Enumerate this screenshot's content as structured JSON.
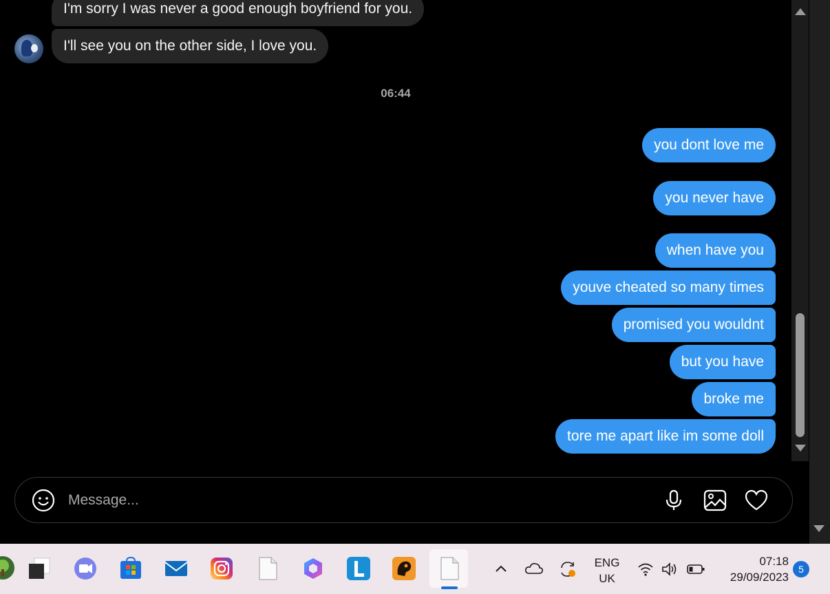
{
  "messages_in": [
    {
      "text": "I'm sorry I was never a good enough boyfriend for you."
    },
    {
      "text": "I'll see you on the other side, I love you."
    }
  ],
  "timestamp": "06:44",
  "messages_out": [
    {
      "text": "you dont love me"
    },
    {
      "text": "you never have"
    },
    {
      "text": "when have you"
    },
    {
      "text": "youve cheated so many times"
    },
    {
      "text": "promised you wouldnt"
    },
    {
      "text": "but you have"
    },
    {
      "text": "broke me"
    },
    {
      "text": "tore me apart like im some doll"
    }
  ],
  "composer": {
    "placeholder": "Message...",
    "icons": [
      "emoji-icon",
      "microphone-icon",
      "image-icon",
      "heart-icon"
    ]
  },
  "colors": {
    "outgoing_bubble": "#3797f0",
    "incoming_bubble": "#262626",
    "background": "#000000",
    "taskbar": "#efe6eb"
  },
  "taskbar": {
    "apps": [
      "tree-app-icon",
      "task-view-icon",
      "teams-icon",
      "microsoft-store-icon",
      "mail-icon",
      "instagram-icon",
      "file-icon",
      "copilot-icon",
      "l-app-icon",
      "game-app-icon",
      "active-file-icon"
    ],
    "language_line1": "ENG",
    "language_line2": "UK",
    "time": "07:18",
    "date": "29/09/2023",
    "notification_count": "5"
  }
}
